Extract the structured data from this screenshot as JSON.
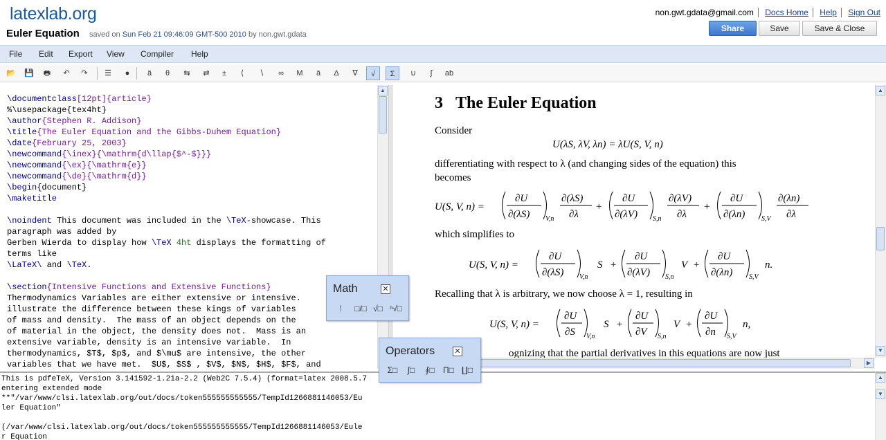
{
  "app": {
    "logo": "latexlab.org"
  },
  "document": {
    "title": "Euler Equation",
    "saved_prefix": "saved on",
    "saved_date": "Sun Feb 21 09:46:09 GMT-500 2010",
    "saved_by": "by non.gwt.gdata"
  },
  "user": {
    "email": "non.gwt.gdata@gmail.com",
    "links": [
      "Docs Home",
      "Help",
      "Sign Out"
    ]
  },
  "buttons": {
    "share": "Share",
    "save": "Save",
    "save_close": "Save & Close"
  },
  "menu": [
    "File",
    "Edit",
    "Export",
    "View",
    "Compiler",
    "Help"
  ],
  "toolbar_icons": [
    {
      "name": "open-folder-icon",
      "glyph": "📂"
    },
    {
      "name": "save-icon",
      "glyph": "💾"
    },
    {
      "name": "print-icon",
      "glyph": "🖶"
    },
    {
      "name": "undo-icon",
      "glyph": "↶"
    },
    {
      "name": "redo-icon",
      "glyph": "↷"
    },
    {
      "name": "outline-icon",
      "glyph": "☰"
    },
    {
      "name": "record-icon",
      "glyph": "●"
    },
    {
      "name": "math-accent-icon",
      "glyph": "ä"
    },
    {
      "name": "greek-icon",
      "glyph": "θ"
    },
    {
      "name": "relations-icon",
      "glyph": "⇆"
    },
    {
      "name": "arrows-icon",
      "glyph": "⇄"
    },
    {
      "name": "binary-operators-icon",
      "glyph": "±"
    },
    {
      "name": "delimiters-icon",
      "glyph": "⟨"
    },
    {
      "name": "misc-symbols-icon",
      "glyph": "∖"
    },
    {
      "name": "misc-math-icon",
      "glyph": "∞"
    },
    {
      "name": "text-mode-icon",
      "glyph": "M"
    },
    {
      "name": "accents-icon",
      "glyph": "ä"
    },
    {
      "name": "large-symbols-icon",
      "glyph": "Δ"
    },
    {
      "name": "nabla-icon",
      "glyph": "∇"
    },
    {
      "name": "math-palette-icon",
      "glyph": "√"
    },
    {
      "name": "operators-palette-icon",
      "glyph": "Σ"
    },
    {
      "name": "sets-icon",
      "glyph": "∪"
    },
    {
      "name": "logic-icon",
      "glyph": "∫"
    },
    {
      "name": "spellcheck-icon",
      "glyph": "ab"
    }
  ],
  "editor_lines": [
    [
      {
        "t": "\\documentclass",
        "c": "cmd"
      },
      {
        "t": "[12pt]{article}",
        "c": "arg"
      }
    ],
    [
      {
        "t": "%\\usepackage{tex4ht}",
        "c": ""
      }
    ],
    [
      {
        "t": "\\author",
        "c": "cmd"
      },
      {
        "t": "{Stephen R. Addison}",
        "c": "arg"
      }
    ],
    [
      {
        "t": "\\title",
        "c": "cmd"
      },
      {
        "t": "{The Euler Equation and the Gibbs-Duhem Equation}",
        "c": "arg"
      }
    ],
    [
      {
        "t": "\\date",
        "c": "cmd"
      },
      {
        "t": "{February 25, 2003}",
        "c": "arg"
      }
    ],
    [
      {
        "t": "\\newcommand",
        "c": "cmd"
      },
      {
        "t": "{\\inex}{\\mathrm{d\\llap{$^-$}}}",
        "c": "arg"
      }
    ],
    [
      {
        "t": "\\newcommand",
        "c": "cmd"
      },
      {
        "t": "{\\ex}{\\mathrm{e}}",
        "c": "arg"
      }
    ],
    [
      {
        "t": "\\newcommand",
        "c": "cmd"
      },
      {
        "t": "{\\de}{\\mathrm{d}}",
        "c": "arg"
      }
    ],
    [
      {
        "t": "\\begin",
        "c": "cmd"
      },
      {
        "t": "{document}",
        "c": ""
      }
    ],
    [
      {
        "t": "\\maketitle",
        "c": "cmd"
      }
    ],
    [
      {
        "t": "",
        "c": ""
      }
    ],
    [
      {
        "t": "\\noindent",
        "c": "cmd"
      },
      {
        "t": " This document was included in the ",
        "c": ""
      },
      {
        "t": "\\TeX",
        "c": "cmd"
      },
      {
        "t": "-showcase. This",
        "c": ""
      }
    ],
    [
      {
        "t": "paragraph was added by",
        "c": ""
      }
    ],
    [
      {
        "t": "Gerben Wierda to display how ",
        "c": ""
      },
      {
        "t": "\\TeX",
        "c": "cmd"
      },
      {
        "t": " 4ht",
        "c": "kw"
      },
      {
        "t": " displays the formatting of",
        "c": ""
      }
    ],
    [
      {
        "t": "terms like",
        "c": ""
      }
    ],
    [
      {
        "t": "\\LaTeX\\",
        "c": "cmd"
      },
      {
        "t": " and ",
        "c": ""
      },
      {
        "t": "\\TeX",
        "c": "cmd"
      },
      {
        "t": ".",
        "c": ""
      }
    ],
    [
      {
        "t": "",
        "c": ""
      }
    ],
    [
      {
        "t": "\\section",
        "c": "cmd"
      },
      {
        "t": "{Intensive Functions and Extensive Functions}",
        "c": "arg"
      }
    ],
    [
      {
        "t": "Thermodynamics Variables are either extensive or intensive.",
        "c": ""
      }
    ],
    [
      {
        "t": "illustrate the difference between these kings of variables",
        "c": ""
      }
    ],
    [
      {
        "t": "of mass and density.  The mass of an object depends on the",
        "c": ""
      }
    ],
    [
      {
        "t": "of material in the object, the density does not.  Mass is an",
        "c": ""
      }
    ],
    [
      {
        "t": "extensive variable, density is an intensive variable.  In",
        "c": ""
      }
    ],
    [
      {
        "t": "thermodynamics, $T$, $p$, and $\\mu$ are intensive, the other",
        "c": ""
      }
    ],
    [
      {
        "t": "variables that we have met.  $U$, $S$ , $V$, $N$, $H$, $F$, and",
        "c": ""
      }
    ]
  ],
  "preview": {
    "section_number": "3",
    "section_title": "The Euler Equation",
    "consider": "Consider",
    "eq1": "U(λS, λV, λn) = λU(S, V, n)",
    "para1_line1": "differentiating with respect to λ (and changing sides of the equation) this",
    "para1_line2": "becomes",
    "eq2_lhs": "U(S, V, n) =",
    "simplifies": "which simplifies to",
    "eq3_lhs": "U(S, V, n) =",
    "recalling": "Recalling that λ is arbitrary, we now choose λ = 1, resulting in",
    "eq4_lhs": "U(S, V, n) =",
    "cutoff": "ognizing that the partial derivatives in this equations are now just",
    "dU": "∂U",
    "d_lS": "∂(λS)",
    "d_lV": "∂(λV)",
    "d_ln": "∂(λn)",
    "d_l": "∂λ",
    "dS": "∂S",
    "dV": "∂V",
    "dn": "∂n",
    "sub_Vn": "V,n",
    "sub_Sn": "S,n",
    "sub_SV": "S,V",
    "plus": "+",
    "S": "S",
    "V": "V",
    "n_dot": "n.",
    "n_comma": "n,"
  },
  "console_lines": [
    "This is pdfeTeX, Version 3.141592-1.21a-2.2 (Web2C 7.5.4) (format=latex 2008.5.7",
    "entering extended mode",
    "**\"/var/www/clsi.latexlab.org/out/docs/token555555555555/TempId1266881146053/Eu",
    "ler Equation\"",
    "",
    "(/var/www/clsi.latexlab.org/out/docs/token555555555555/TempId1266881146053/Eule",
    "r Equation"
  ],
  "palettes": {
    "math": {
      "title": "Math",
      "buttons": [
        "⁞",
        "□/□",
        "√□",
        "ⁿ√□"
      ]
    },
    "operators": {
      "title": "Operators",
      "buttons": [
        "Σ□",
        "∫□",
        "∮□",
        "Π□",
        "∐□"
      ]
    }
  }
}
